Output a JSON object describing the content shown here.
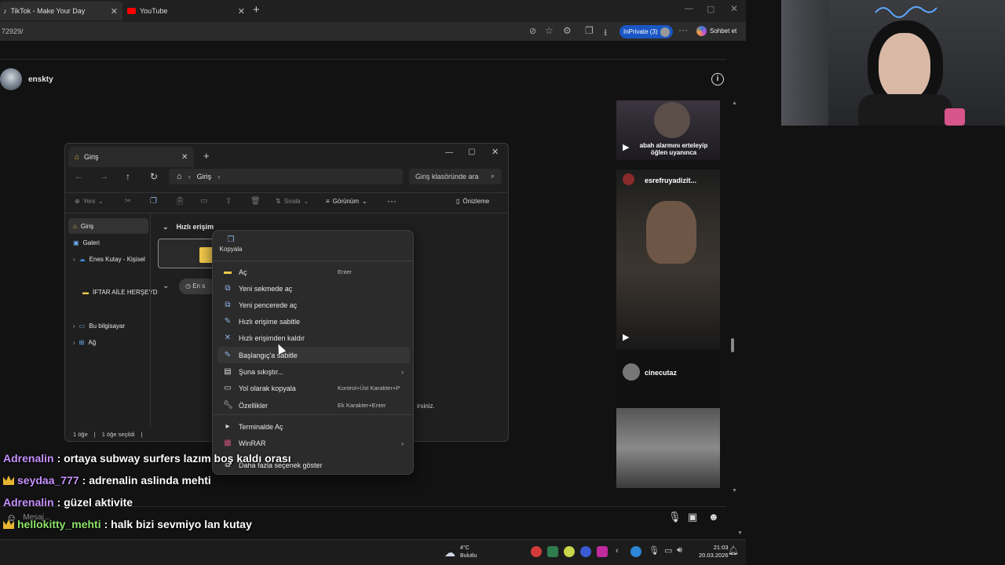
{
  "browser": {
    "tabs": [
      {
        "title": "TikTok - Make Your Day"
      },
      {
        "title": "YouTube"
      }
    ],
    "url": "72929/",
    "inprivate_label": "InPrivate (3)",
    "chat_button": "Sohbet et"
  },
  "tiktok": {
    "username": "enskty",
    "rail": {
      "item1_caption_line1": "abah alarmını erteleyip",
      "item1_caption_line2": "öğlen uyanınca",
      "item2_user": "esrefruyadizit...",
      "item3_user": "cinecutaz"
    },
    "message_placeholder": "Mesaj..."
  },
  "explorer": {
    "tab_title": "Giriş",
    "breadcrumb": "Giriş",
    "search_placeholder": "Giriş klasöründe ara",
    "toolbar": {
      "new": "Yeni",
      "sort": "Sırala",
      "view": "Görünüm",
      "preview": "Önizleme"
    },
    "sidebar": [
      {
        "label": "Giriş"
      },
      {
        "label": "Galeri"
      },
      {
        "label": "Enes Kutay - Kişisel"
      },
      {
        "label": "İFTAR AİLE HERŞEYD"
      },
      {
        "label": "Bu bilgisayar"
      },
      {
        "label": "Ağ"
      }
    ],
    "section_quick": "Hızlı erişim",
    "recent_chip": "En s",
    "hidden_text": "irsiniz.",
    "status_items": "1 öğe",
    "status_selected": "1 öğe seçildi"
  },
  "context_menu": {
    "copy_label": "Kopyala",
    "items": [
      {
        "label": "Aç",
        "shortcut": "Enter"
      },
      {
        "label": "Yeni sekmede aç",
        "shortcut": ""
      },
      {
        "label": "Yeni pencerede aç",
        "shortcut": ""
      },
      {
        "label": "Hızlı erişime sabitle",
        "shortcut": ""
      },
      {
        "label": "Hızlı erişimden kaldır",
        "shortcut": ""
      },
      {
        "label": "Başlangıç'a sabitle",
        "shortcut": ""
      },
      {
        "label": "Şuna sıkıştır...",
        "shortcut": ""
      },
      {
        "label": "Yol olarak kopyala",
        "shortcut": "Kontrol+Üst Karakter+P"
      },
      {
        "label": "Özellikler",
        "shortcut": "Ek Karakter+Enter"
      },
      {
        "label": "Terminalde Aç",
        "shortcut": ""
      },
      {
        "label": "WinRAR",
        "shortcut": ""
      },
      {
        "label": "Daha fazla seçenek göster",
        "shortcut": ""
      }
    ]
  },
  "chat": [
    {
      "user": "Adrenalin",
      "message": ": ortaya subway surfers lazım boş kaldı orası",
      "color": "#c792ff",
      "crown": false
    },
    {
      "user": "seydaa_777",
      "message": ": adrenalin aslinda mehti",
      "color": "#c792ff",
      "crown": true
    },
    {
      "user": "Adrenalin",
      "message": ": güzel aktivite",
      "color": "#c792ff",
      "crown": false
    },
    {
      "user": "hellokitty_mehti",
      "message": ": halk bizi sevmiyo lan kutay",
      "color": "#8ee26b",
      "crown": true
    }
  ],
  "taskbar": {
    "weather_temp": "4°C",
    "weather_desc": "Bulutlu",
    "time": "21:03",
    "date": "20.03.2026"
  }
}
